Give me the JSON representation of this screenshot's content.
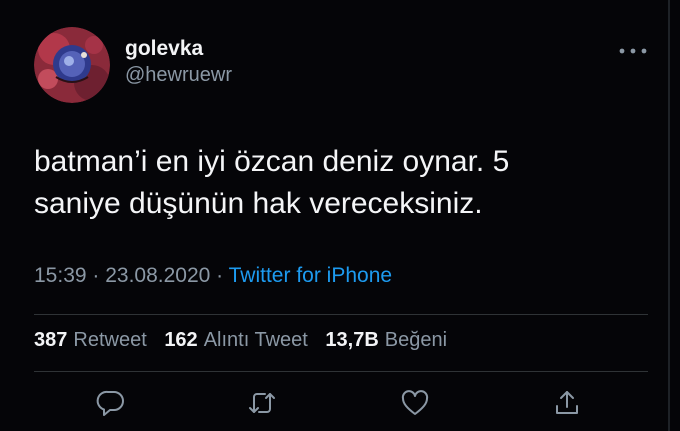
{
  "user": {
    "display_name": "golevka",
    "handle": "@hewruewr",
    "avatar_icon": "avatar-image"
  },
  "more_icon": "more-horizontal-icon",
  "tweet": {
    "text_line1": "batman’i en iyi özcan deniz oynar. 5",
    "text_line2": "saniye düşünün hak vereceksiniz."
  },
  "meta": {
    "time": "15:39",
    "separator1": " · ",
    "date": "23.08.2020",
    "separator2": " · ",
    "source": "Twitter for iPhone"
  },
  "stats": {
    "retweet_count": "387",
    "retweet_label": "Retweet",
    "quote_count": "162",
    "quote_label": "Alıntı Tweet",
    "like_count": "13,7B",
    "like_label": "Beğeni"
  },
  "actions": {
    "reply_icon": "reply-icon",
    "retweet_icon": "retweet-icon",
    "like_icon": "heart-icon",
    "share_icon": "share-icon"
  },
  "colors": {
    "background": "#050508",
    "text": "#f4f5f7",
    "muted": "#8b98a5",
    "link": "#1d9bf0",
    "divider": "#2f3336"
  }
}
